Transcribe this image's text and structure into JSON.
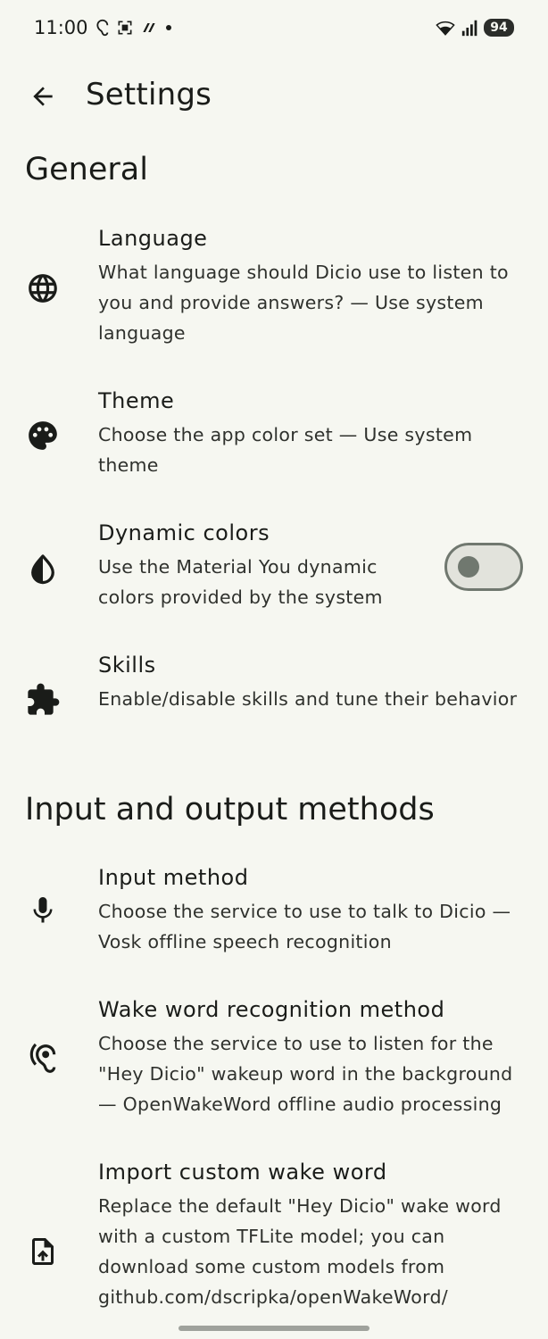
{
  "status": {
    "time": "11:00",
    "battery": "94"
  },
  "header": {
    "title": "Settings"
  },
  "sections": {
    "general": "General",
    "io": "Input and output methods"
  },
  "prefs": {
    "language": {
      "title": "Language",
      "summary": "What language should Dicio use to listen to you and provide answers? — Use system language"
    },
    "theme": {
      "title": "Theme",
      "summary": "Choose the app color set — Use system theme"
    },
    "dynamic_colors": {
      "title": "Dynamic colors",
      "summary": "Use the Material You dynamic colors provided by the system",
      "enabled": false
    },
    "skills": {
      "title": "Skills",
      "summary": "Enable/disable skills and tune their behavior"
    },
    "input_method": {
      "title": "Input method",
      "summary": "Choose the service to use to talk to Dicio — Vosk offline speech recognition"
    },
    "wake_word": {
      "title": "Wake word recognition method",
      "summary": "Choose the service to use to listen for the \"Hey Dicio\" wakeup word in the background — OpenWakeWord offline audio processing"
    },
    "import_wake_word": {
      "title": "Import custom wake word",
      "summary": "Replace the default \"Hey Dicio\" wake word with a custom TFLite model; you can download some custom models from github.com/dscripka/openWakeWord/"
    }
  },
  "icons": {
    "back": "arrow-back-icon",
    "language": "globe-icon",
    "theme": "palette-icon",
    "dynamic_colors": "contrast-icon",
    "skills": "puzzle-icon",
    "input_method": "microphone-icon",
    "wake_word": "hearing-icon",
    "import_wake_word": "file-upload-icon"
  },
  "colors": {
    "background": "#f6f7f1",
    "text": "#1a1c19",
    "toggle_outline": "#70786f",
    "toggle_track": "#e2e3dc"
  }
}
